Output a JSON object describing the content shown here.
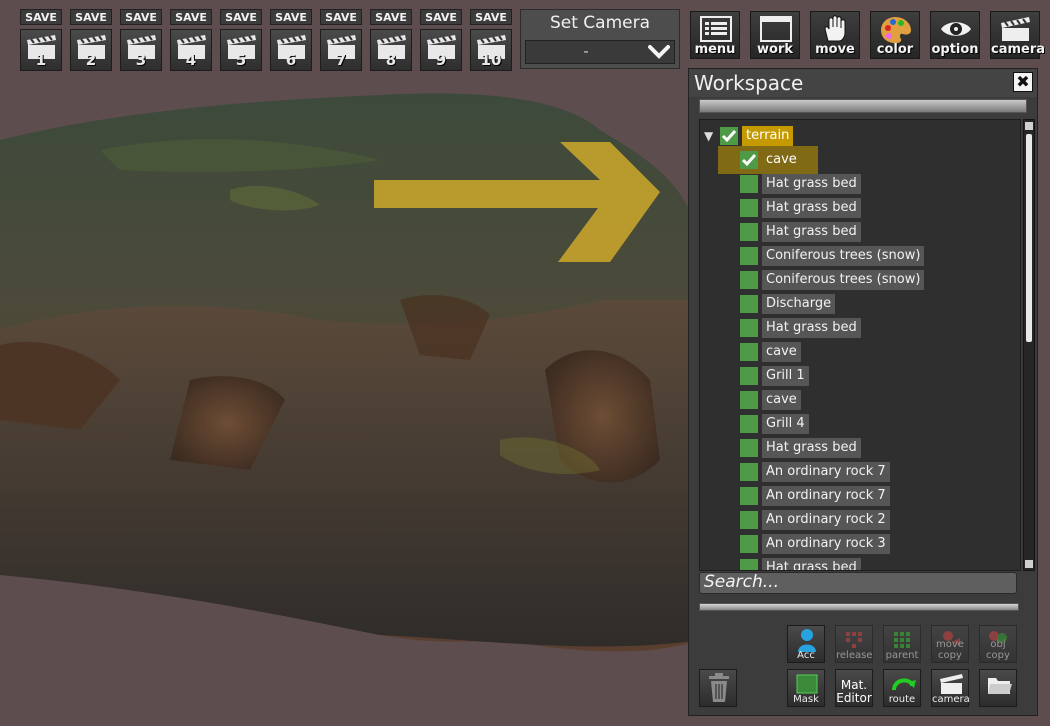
{
  "toolbar": {
    "save_label": "SAVE",
    "save_slots": [
      "1",
      "2",
      "3",
      "4",
      "5",
      "6",
      "7",
      "8",
      "9",
      "10"
    ],
    "set_camera": {
      "title": "Set Camera",
      "value": "-"
    },
    "tools": [
      {
        "label": "menu",
        "icon": "menu-list-icon"
      },
      {
        "label": "work",
        "icon": "window-icon"
      },
      {
        "label": "move",
        "icon": "hand-icon"
      },
      {
        "label": "color",
        "icon": "palette-icon"
      },
      {
        "label": "option",
        "icon": "eye-icon"
      },
      {
        "label": "camera",
        "icon": "clapperboard-icon"
      }
    ]
  },
  "workspace": {
    "title": "Workspace",
    "close_label": "✖",
    "tree": [
      {
        "label": "terrain",
        "checked": true,
        "expanded": true,
        "selected": true,
        "level": 0
      },
      {
        "label": "cave",
        "checked": true,
        "highlight": true,
        "level": 1
      },
      {
        "label": "Hat grass bed",
        "checked": false,
        "level": 1
      },
      {
        "label": "Hat grass bed",
        "checked": false,
        "level": 1
      },
      {
        "label": "Hat grass bed",
        "checked": false,
        "level": 1
      },
      {
        "label": "Coniferous trees (snow)",
        "checked": false,
        "level": 1
      },
      {
        "label": "Coniferous trees (snow)",
        "checked": false,
        "level": 1
      },
      {
        "label": "Discharge",
        "checked": false,
        "level": 1
      },
      {
        "label": "Hat grass bed",
        "checked": false,
        "level": 1
      },
      {
        "label": "cave",
        "checked": false,
        "level": 1
      },
      {
        "label": "Grill 1",
        "checked": false,
        "level": 1
      },
      {
        "label": "cave",
        "checked": false,
        "level": 1
      },
      {
        "label": "Grill 4",
        "checked": false,
        "level": 1
      },
      {
        "label": "Hat grass bed",
        "checked": false,
        "level": 1
      },
      {
        "label": "An ordinary rock 7",
        "checked": false,
        "level": 1
      },
      {
        "label": "An ordinary rock 7",
        "checked": false,
        "level": 1
      },
      {
        "label": "An ordinary rock 2",
        "checked": false,
        "level": 1
      },
      {
        "label": "An ordinary rock 3",
        "checked": false,
        "level": 1
      },
      {
        "label": "Hat grass bed",
        "checked": false,
        "level": 1
      }
    ],
    "search_placeholder": "Search...",
    "buttons_row1": [
      {
        "label": "Acc",
        "icon": "person-icon",
        "disabled": false
      },
      {
        "label": "release",
        "icon": "release-grid-icon",
        "disabled": true
      },
      {
        "label": "parent",
        "icon": "parent-grid-icon",
        "disabled": true
      },
      {
        "label": "move copy",
        "icon": "move-copy-icon",
        "disabled": true
      },
      {
        "label": "obj copy",
        "icon": "obj-copy-icon",
        "disabled": true
      }
    ],
    "buttons_row2": [
      {
        "label": "Mask",
        "icon": "mask-icon",
        "disabled": false
      },
      {
        "label": "Mat. Editor",
        "icon": "",
        "disabled": false
      },
      {
        "label": "route",
        "icon": "route-icon",
        "disabled": false
      },
      {
        "label": "camera",
        "icon": "clapperboard-icon",
        "disabled": false
      },
      {
        "label": "",
        "icon": "folder-icon",
        "disabled": false
      }
    ],
    "trash_icon": "trash-icon"
  }
}
